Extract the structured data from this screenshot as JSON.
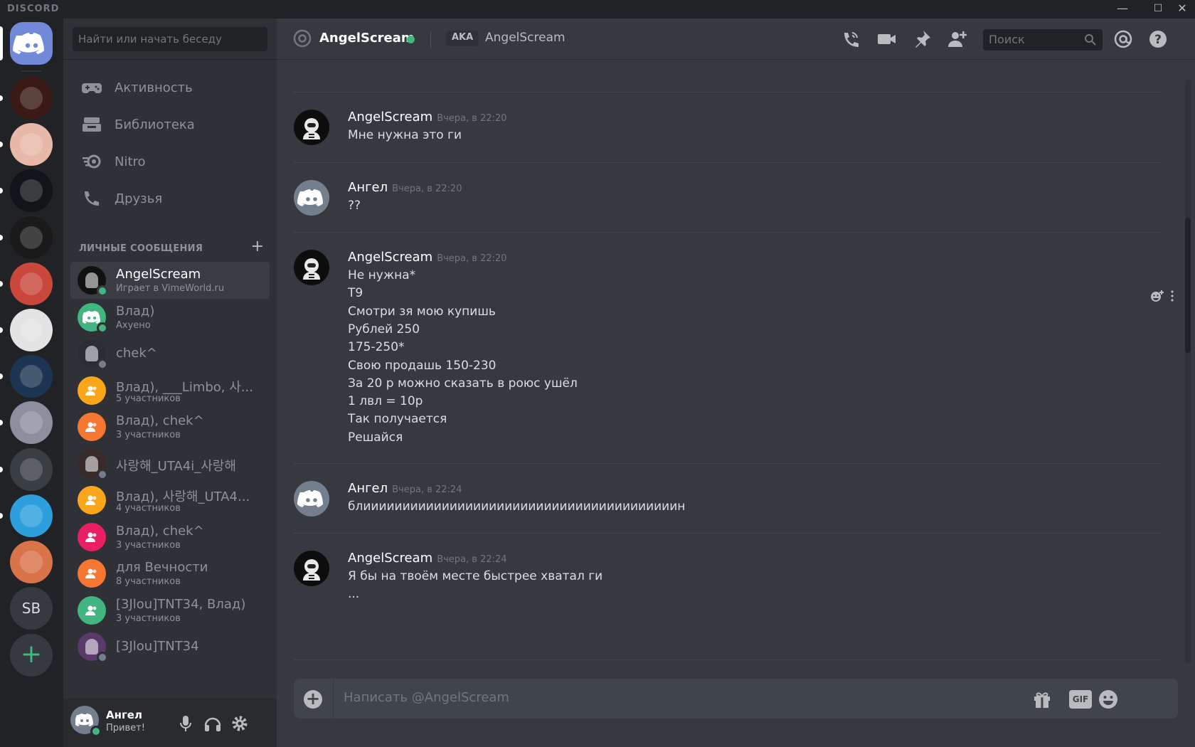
{
  "window": {
    "brand": "DISCORD",
    "minimize": "—",
    "maximize": "☐",
    "close": "✕"
  },
  "servers": [
    {
      "name": "Home",
      "color": "#7289da",
      "kind": "home"
    },
    {
      "name": "server-moon",
      "color": "#3a1a14"
    },
    {
      "name": "server-pig",
      "color": "#e8b9a8"
    },
    {
      "name": "server-b",
      "color": "#111418"
    },
    {
      "name": "server-wings",
      "color": "#1a1a1a"
    },
    {
      "name": "server-minecraft",
      "color": "#c9473b"
    },
    {
      "name": "server-grater",
      "color": "#e3e3e3"
    },
    {
      "name": "server-wolf",
      "color": "#1d3552"
    },
    {
      "name": "server-anime",
      "color": "#8d8f9f"
    },
    {
      "name": "server-soldier",
      "color": "#3a3f44"
    },
    {
      "name": "server-vime",
      "color": "#2d9fdc"
    },
    {
      "name": "server-fox",
      "color": "#d9734a"
    },
    {
      "name": "SB",
      "color": "#36393f",
      "text": "SB"
    },
    {
      "name": "add-server",
      "text": "+",
      "color": "#36393f"
    }
  ],
  "sidebar": {
    "search_placeholder": "Найти или начать беседу",
    "nav": [
      {
        "label": "Активность",
        "icon": "gamepad-icon"
      },
      {
        "label": "Библиотека",
        "icon": "library-icon"
      },
      {
        "label": "Nitro",
        "icon": "nitro-icon"
      },
      {
        "label": "Друзья",
        "icon": "friends-icon"
      }
    ],
    "dm_header": "ЛИЧНЫЕ СООБЩЕНИЯ",
    "dm_add": "+",
    "dms": [
      {
        "name": "AngelScream",
        "sub": "Играет в VimeWorld.ru",
        "avatar": "#111",
        "status": "#43b581",
        "active": true,
        "kind": "user"
      },
      {
        "name": "Влад)",
        "sub": "Ахуено",
        "avatar": "#43b581",
        "status": "#43b581",
        "kind": "discord"
      },
      {
        "name": "chek^",
        "sub": "",
        "avatar": "#2a2e33",
        "status": "#747f8d",
        "kind": "user"
      },
      {
        "name": "Влад), ___Limbo, 사...",
        "sub": "5 участников",
        "avatar": "#faa61a",
        "kind": "group"
      },
      {
        "name": "Влад), chek^",
        "sub": "3 участников",
        "avatar": "#f57731",
        "kind": "group"
      },
      {
        "name": "사랑해_UTA4i_사랑해",
        "sub": "",
        "avatar": "#3b2a2a",
        "status": "#747f8d",
        "kind": "user"
      },
      {
        "name": "Влад), 사랑해_UTA4...",
        "sub": "4 участников",
        "avatar": "#faa61a",
        "kind": "group"
      },
      {
        "name": "Влад), chek^",
        "sub": "3 участников",
        "avatar": "#e91e63",
        "kind": "group"
      },
      {
        "name": "для Вечности",
        "sub": "8 участников",
        "avatar": "#f57731",
        "kind": "group"
      },
      {
        "name": "[3Jlou]TNT34, Влад)",
        "sub": "3 участников",
        "avatar": "#43b581",
        "kind": "group"
      },
      {
        "name": "[3Jlou]TNT34",
        "sub": "",
        "avatar": "#5a3a6a",
        "status": "#747f8d",
        "kind": "user"
      }
    ]
  },
  "user": {
    "name": "Ангел",
    "status": "Привет!"
  },
  "chat": {
    "title": "AngelScream",
    "aka": "AKA",
    "nick": "AngelScream",
    "search_placeholder": "Поиск",
    "composer_placeholder": "Написать @AngelScream",
    "gif": "GIF",
    "messages": [
      {
        "author": "AngelScream",
        "time": "Вчера, в 22:20",
        "lines": [
          "Мне нужна это ги"
        ],
        "avatar": "angel"
      },
      {
        "author": "Ангел",
        "time": "Вчера, в 22:20",
        "lines": [
          "??"
        ],
        "avatar": "discord"
      },
      {
        "author": "AngelScream",
        "time": "Вчера, в 22:20",
        "lines": [
          "Не нужна*",
          "Т9",
          "Смотри зя мою купишь",
          "Рублей 250",
          "175-250*",
          "Свою продашь 150-230",
          "За 20 р можно сказать в роюс ушёл",
          "1 лвл = 10р",
          "Так получается",
          "Решайся"
        ],
        "avatar": "angel"
      },
      {
        "author": "Ангел",
        "time": "Вчера, в 22:24",
        "lines": [
          "блиииииииииииииииииииииииииииииииииииииииин"
        ],
        "avatar": "discord"
      },
      {
        "author": "AngelScream",
        "time": "Вчера, в 22:24",
        "lines": [
          "Я бы на твоём месте быстрее хватал ги",
          "..."
        ],
        "avatar": "angel"
      }
    ]
  },
  "colors": {
    "online": "#43b581",
    "idle": "#747f8d",
    "blurple": "#7289da"
  }
}
